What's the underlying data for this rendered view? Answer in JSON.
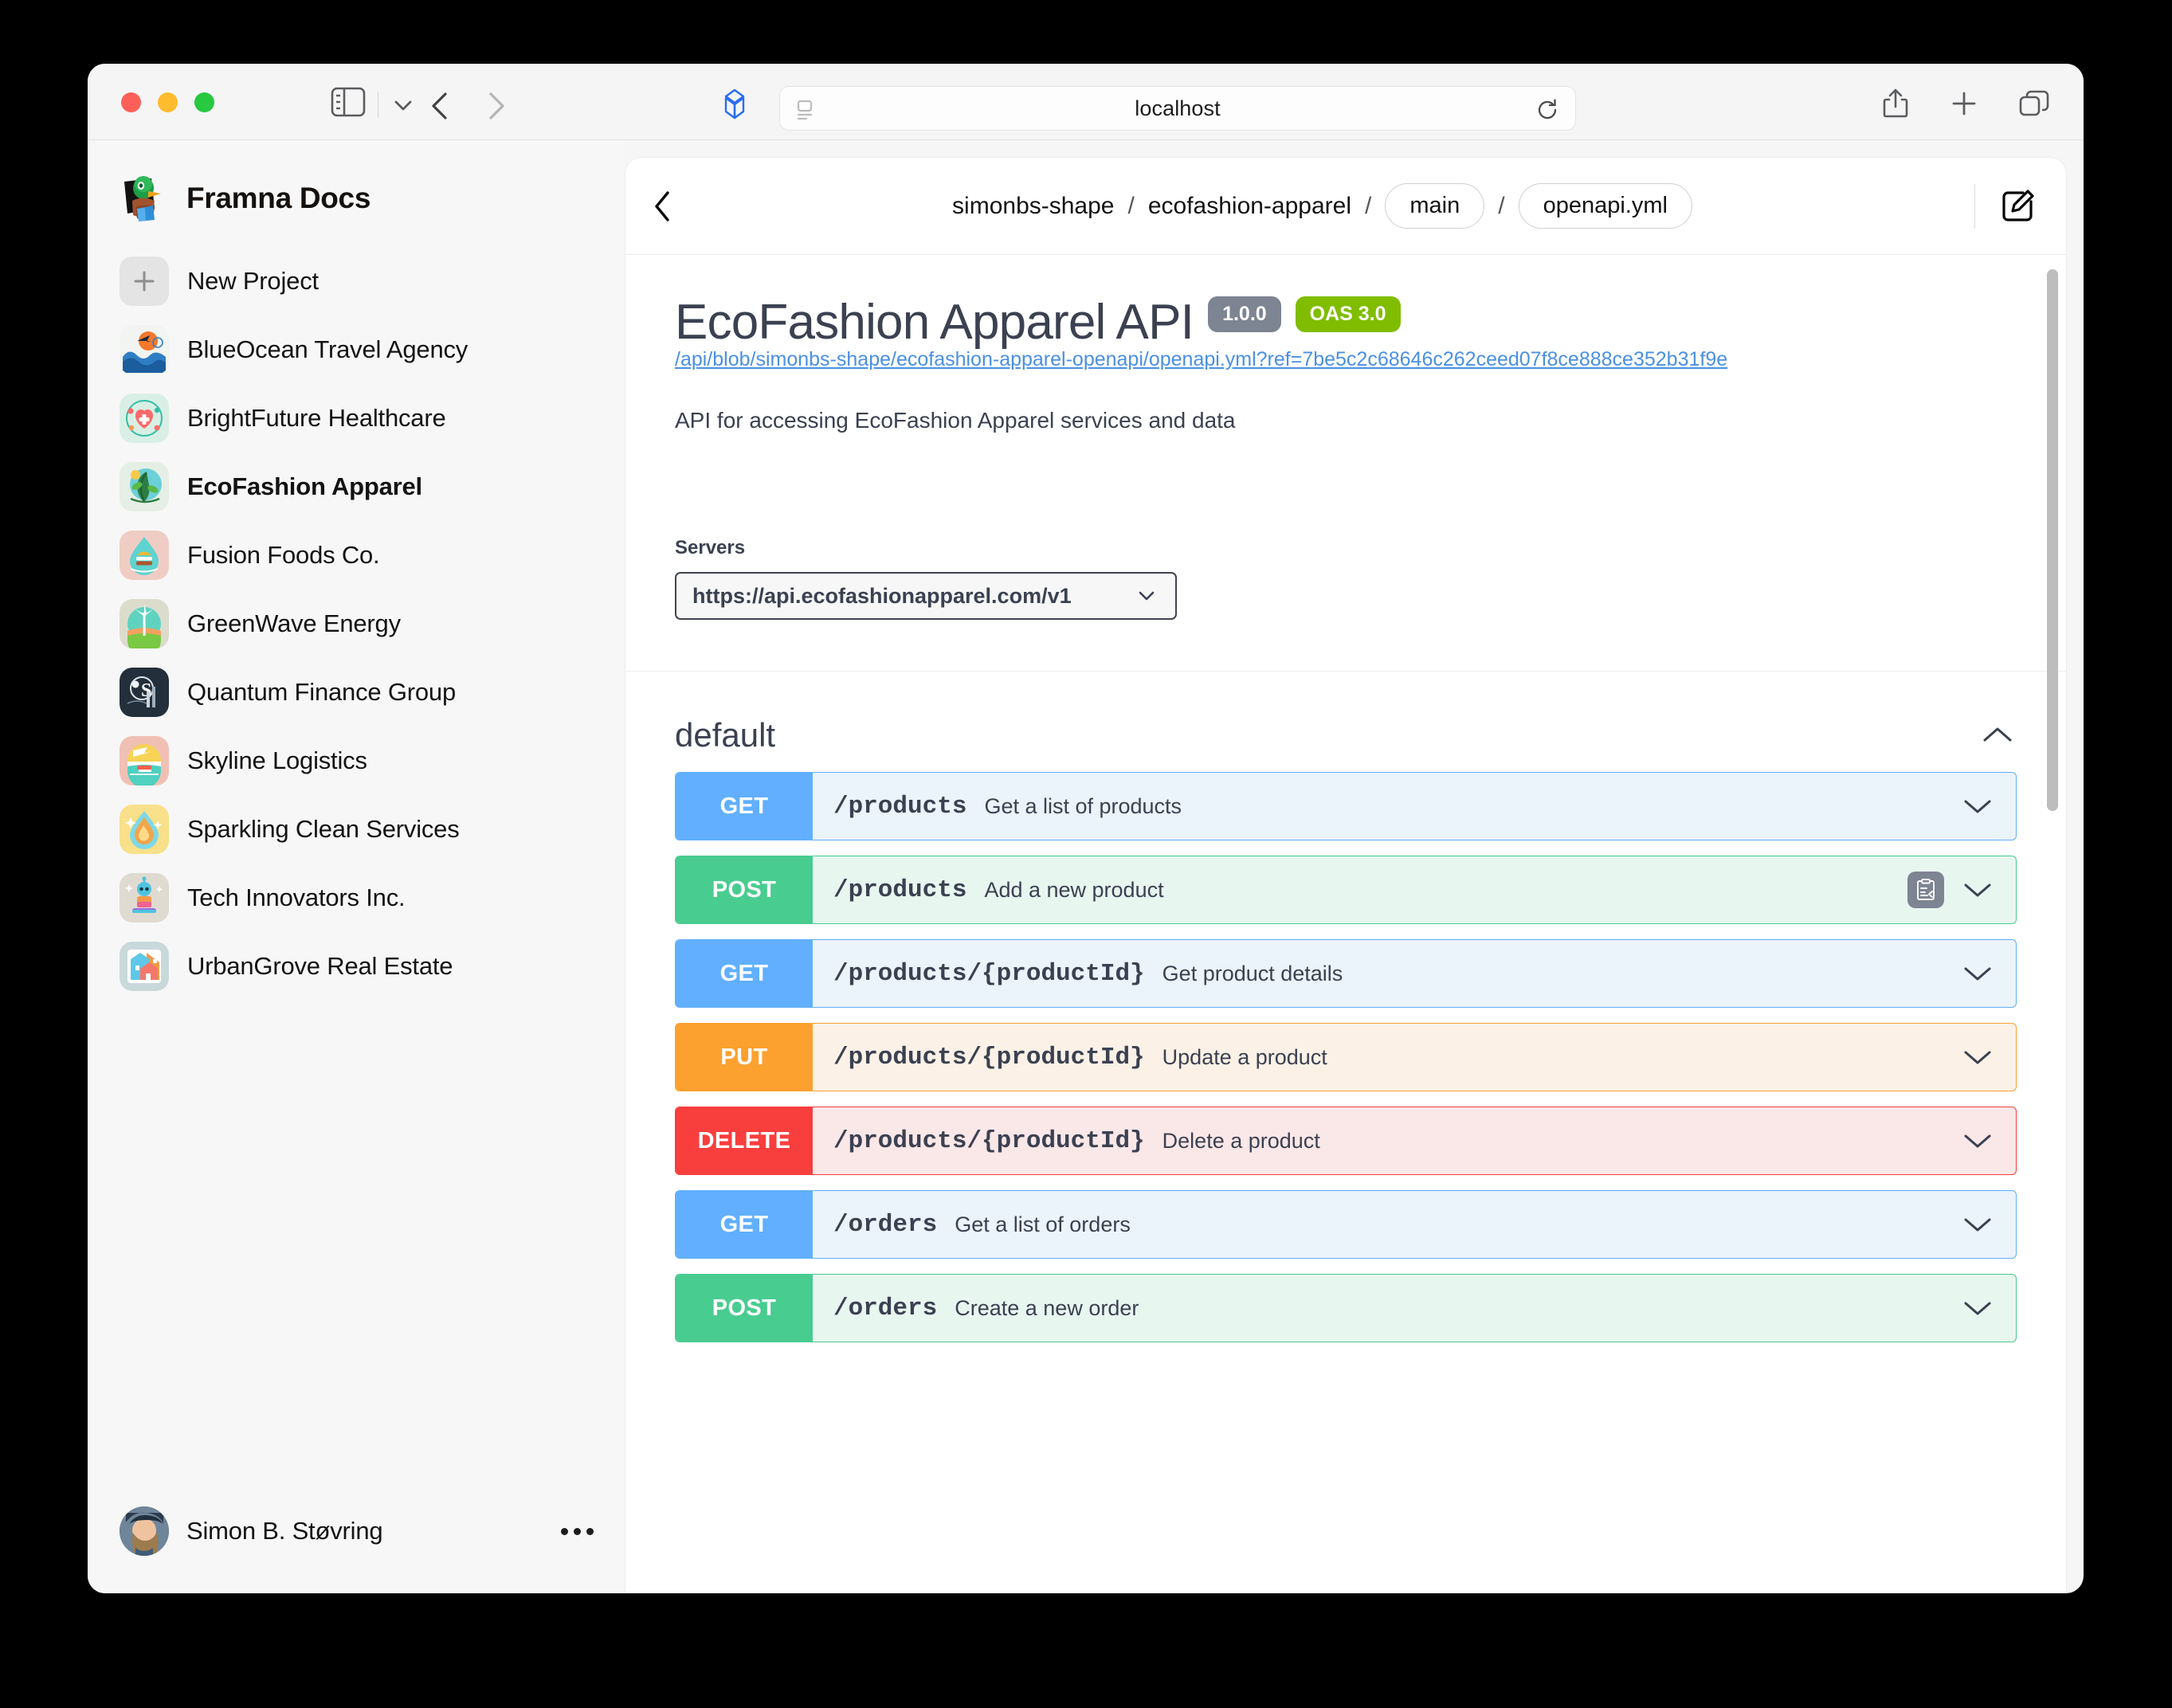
{
  "browser": {
    "address": "localhost",
    "icons": {
      "sidebar_toggle": "sidebar-toggle-icon",
      "chevron_down": "chevron-down-icon",
      "back": "back-chevron-icon",
      "forward": "forward-chevron-icon",
      "shape_logo": "shape-logo-icon",
      "reader": "reader-view-icon",
      "reload": "reload-icon",
      "share": "share-icon",
      "new_tab": "plus-icon",
      "tab_overview": "tab-overview-icon"
    }
  },
  "sidebar": {
    "brand": "Framna Docs",
    "items": [
      {
        "label": "New Project",
        "icon": "plus-icon",
        "active": false
      },
      {
        "label": "BlueOcean Travel Agency",
        "icon": "blueocean-thumbnail",
        "active": false
      },
      {
        "label": "BrightFuture Healthcare",
        "icon": "brightfuture-thumbnail",
        "active": false
      },
      {
        "label": "EcoFashion Apparel",
        "icon": "ecofashion-thumbnail",
        "active": true
      },
      {
        "label": "Fusion Foods Co.",
        "icon": "fusionfoods-thumbnail",
        "active": false
      },
      {
        "label": "GreenWave Energy",
        "icon": "greenwave-thumbnail",
        "active": false
      },
      {
        "label": "Quantum Finance Group",
        "icon": "quantum-thumbnail",
        "active": false
      },
      {
        "label": "Skyline Logistics",
        "icon": "skyline-thumbnail",
        "active": false
      },
      {
        "label": "Sparkling Clean Services",
        "icon": "sparkling-thumbnail",
        "active": false
      },
      {
        "label": "Tech Innovators Inc.",
        "icon": "techinnovators-thumbnail",
        "active": false
      },
      {
        "label": "UrbanGrove Real Estate",
        "icon": "urbangrove-thumbnail",
        "active": false
      }
    ],
    "user": {
      "name": "Simon B. Støvring",
      "more_icon": "ellipsis-icon"
    }
  },
  "breadcrumb": {
    "back_icon": "back-chevron-icon",
    "owner": "simonbs-shape",
    "repo": "ecofashion-apparel",
    "separator": "/",
    "branch": "main",
    "file": "openapi.yml",
    "edit_icon": "edit-icon"
  },
  "api": {
    "title": "EcoFashion Apparel API",
    "version_badge": "1.0.0",
    "spec_badge": "OAS 3.0",
    "source_url": "/api/blob/simonbs-shape/ecofashion-apparel-openapi/openapi.yml?ref=7be5c2c68646c262ceed07f8ce888ce352b31f9e",
    "description": "API for accessing EcoFashion Apparel services and data",
    "servers_label": "Servers",
    "server_selected": "https://api.ecofashionapparel.com/v1",
    "server_chevron": "chevron-down-icon"
  },
  "tag": {
    "name": "default",
    "collapse_icon": "chevron-up-icon"
  },
  "operations": [
    {
      "method": "GET",
      "style": "get",
      "path": "/products",
      "summary": "Get a list of products",
      "has_copy": false,
      "expand_icon": "chevron-down-icon"
    },
    {
      "method": "POST",
      "style": "post",
      "path": "/products",
      "summary": "Add a new product",
      "has_copy": true,
      "copy_icon": "request-body-icon",
      "expand_icon": "chevron-down-icon"
    },
    {
      "method": "GET",
      "style": "get",
      "path": "/products/{productId}",
      "summary": "Get product details",
      "has_copy": false,
      "expand_icon": "chevron-down-icon"
    },
    {
      "method": "PUT",
      "style": "put",
      "path": "/products/{productId}",
      "summary": "Update a product",
      "has_copy": false,
      "expand_icon": "chevron-down-icon"
    },
    {
      "method": "DELETE",
      "style": "delete",
      "path": "/products/{productId}",
      "summary": "Delete a product",
      "has_copy": false,
      "expand_icon": "chevron-down-icon"
    },
    {
      "method": "GET",
      "style": "get",
      "path": "/orders",
      "summary": "Get a list of orders",
      "has_copy": false,
      "expand_icon": "chevron-down-icon"
    },
    {
      "method": "POST",
      "style": "post",
      "path": "/orders",
      "summary": "Create a new order",
      "has_copy": false,
      "expand_icon": "chevron-down-icon"
    }
  ],
  "colors": {
    "get": "#61affe",
    "post": "#49cc90",
    "put": "#fca130",
    "delete": "#f93e3e",
    "version_badge": "#7d8492",
    "oas_badge": "#80bd00",
    "link": "#4a90e2",
    "text": "#3b4151"
  }
}
